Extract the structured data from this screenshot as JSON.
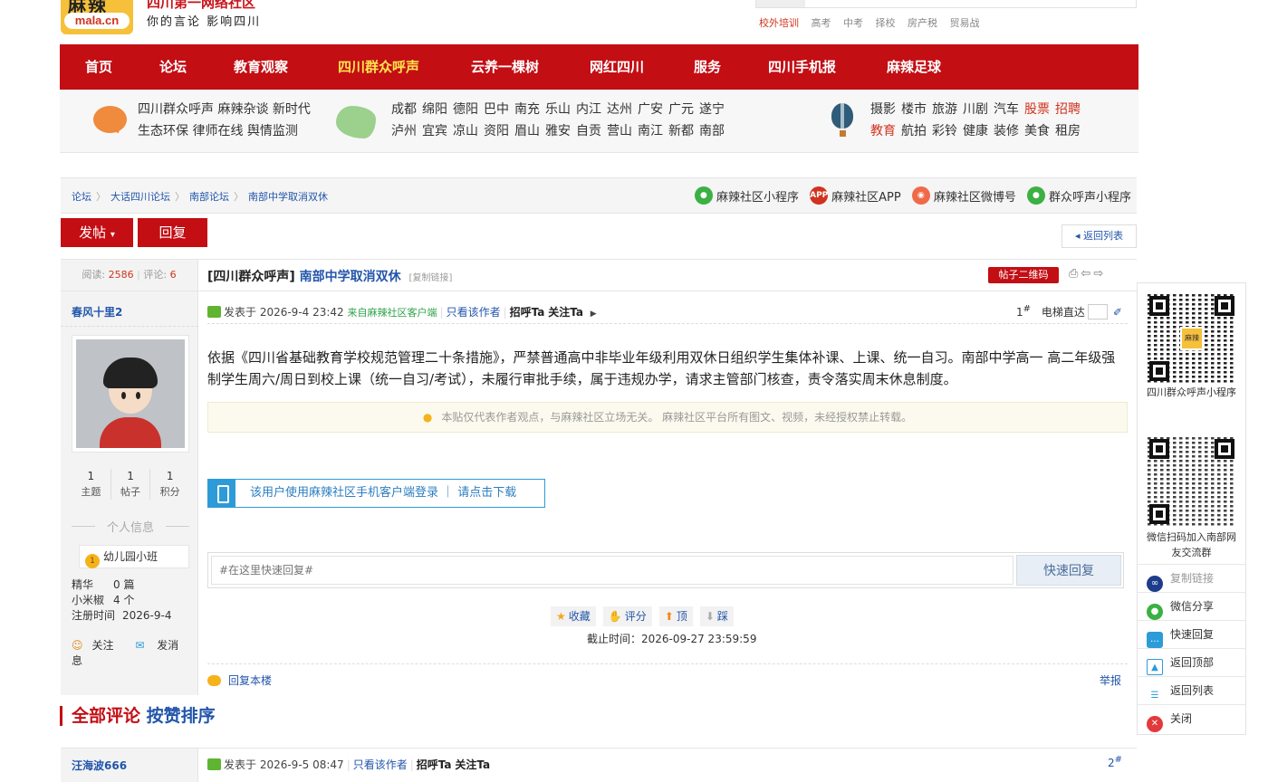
{
  "header": {
    "logo_top": "麻辣",
    "logo_text": "mala.cn",
    "slogan_top": "四川第一网络社区",
    "slogan": "你的言论 影响四川",
    "top_links": [
      "校外培训",
      "高考",
      "中考",
      "择校",
      "房产税",
      "贸易战"
    ]
  },
  "nav": {
    "items": [
      "首页",
      "论坛",
      "教育观察",
      "四川群众呼声",
      "云养一棵树",
      "网红四川",
      "服务",
      "四川手机报",
      "麻辣足球"
    ],
    "active_index": 3
  },
  "subnav": {
    "col1": [
      "四川群众呼声 麻辣杂谈 新时代",
      "生态环保 律师在线 舆情监测"
    ],
    "cities_row1": [
      "成都",
      "绵阳",
      "德阳",
      "巴中",
      "南充",
      "乐山",
      "内江",
      "达州",
      "广安",
      "广元",
      "遂宁"
    ],
    "cities_row2": [
      "泸州",
      "宜宾",
      "凉山",
      "资阳",
      "眉山",
      "雅安",
      "自贡",
      "营山",
      "南江",
      "新都",
      "南部"
    ],
    "life_row1": [
      "摄影",
      "楼市",
      "旅游",
      "川剧",
      "汽车",
      "股票",
      "招聘"
    ],
    "life_row2": [
      "教育",
      "航拍",
      "彩铃",
      "健康",
      "装修",
      "美食",
      "租房"
    ]
  },
  "breadcrumb": [
    "论坛",
    "大话四川论坛",
    "南部论坛",
    "南部中学取消双休"
  ],
  "share_links": [
    "麻辣社区小程序",
    "麻辣社区APP",
    "麻辣社区微博号",
    "群众呼声小程序"
  ],
  "buttons": {
    "post": "发帖",
    "reply": "回复",
    "back": "返回列表",
    "qr": "帖子二维码"
  },
  "thread": {
    "read_label": "阅读:",
    "read": "2586",
    "comment_label": "评论:",
    "comments": "6",
    "tag": "[四川群众呼声]",
    "title": "南部中学取消双休",
    "copy": "[复制链接]"
  },
  "author": {
    "name": "春风十里2",
    "counts": [
      {
        "value": "1",
        "label": "主题"
      },
      {
        "value": "1",
        "label": "帖子"
      },
      {
        "value": "1",
        "label": "积分"
      }
    ],
    "info_title": "个人信息",
    "level": "幼儿园小班",
    "meta": [
      {
        "k": "精华",
        "v": "0 篇"
      },
      {
        "k": "小米椒",
        "v": "4 个"
      },
      {
        "k": "注册时间",
        "v": "2026-9-4"
      }
    ],
    "follow": "关注",
    "message": "发消息"
  },
  "post": {
    "posted": "发表于 2026-9-4 23:42",
    "client": "来自麻辣社区客户端",
    "only_author": "只看该作者",
    "greet": "招呼Ta",
    "follow": "关注Ta",
    "floor": "1",
    "floor_sup": "#",
    "jump_label": "电梯直达",
    "body": "依据《四川省基础教育学校规范管理二十条措施》，严禁普通高中非毕业年级利用双休日组织学生集体补课、上课、统一自习。南部中学高一 高二年级强制学生周六/周日到校上课（统一自习/考试），未履行审批手续，属于违规办学，请求主管部门核查，责令落实周末休息制度。",
    "notice": "本贴仅代表作者观点，与麻辣社区立场无关。 麻辣社区平台所有图文、视频，未经授权禁止转载。",
    "app_prompt": "该用户使用麻辣社区手机客户端登录 ｜ 请点击下载",
    "reply_placeholder": "#在这里快速回复#",
    "quick_reply": "快速回复",
    "votes": [
      "收藏",
      "评分",
      "顶",
      "踩"
    ],
    "deadline": "截止时间：2026-09-27 23:59:59",
    "reply_floor": "回复本楼",
    "report": "举报"
  },
  "comments": {
    "title_a": "全部评论",
    "title_b": "按赞排序",
    "first": {
      "author": "汪海波666",
      "posted": "发表于 2026-9-5 08:47",
      "only_author": "只看该作者",
      "greet": "招呼Ta",
      "follow": "关注Ta",
      "floor": "2",
      "floor_sup": "#"
    }
  },
  "rail": {
    "qr1_caption": "四川群众呼声小程序",
    "qr1_badge": "麻辣",
    "qr2_caption": "微信扫码加入南部网友交流群",
    "items": [
      "复制链接",
      "微信分享",
      "快速回复",
      "返回顶部",
      "返回列表",
      "关闭"
    ]
  }
}
